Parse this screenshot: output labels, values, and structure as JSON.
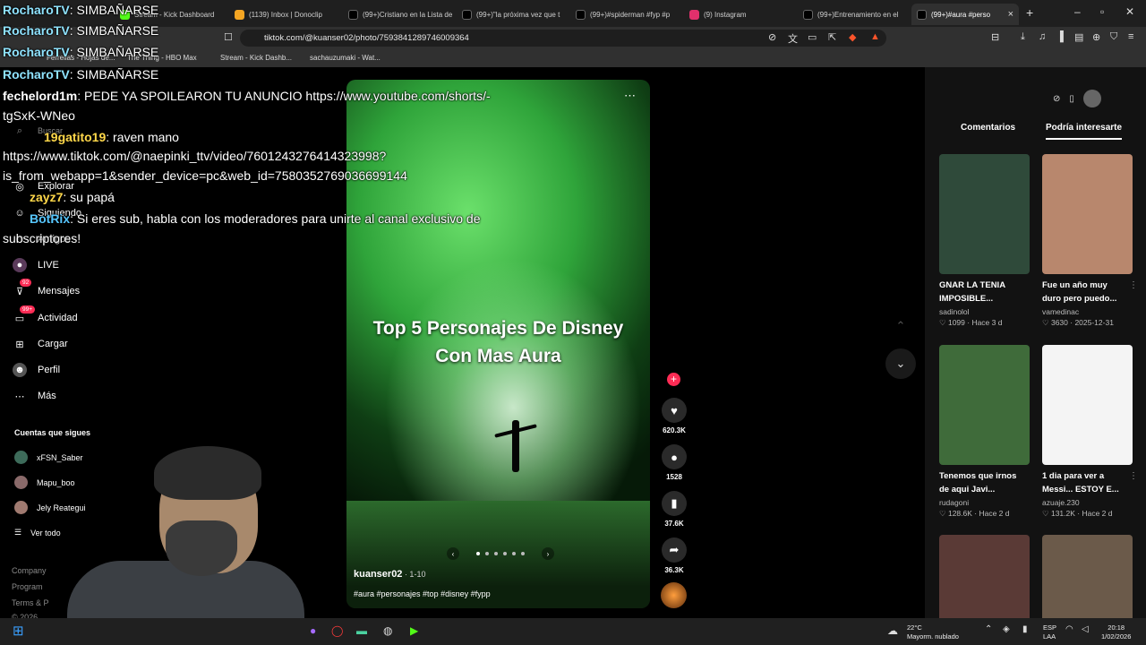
{
  "tabs": [
    {
      "label": "Stream - Kick Dashboard",
      "color": "#53fc18"
    },
    {
      "label": "(1139) Inbox | Donoclip",
      "color": "#f5a623"
    },
    {
      "label": "(99+)Cristiano en la Lista de",
      "color": "#ffffff"
    },
    {
      "label": "(99+)\"la próxima vez que t",
      "color": "#ffffff"
    },
    {
      "label": "(99+)#spiderman #fyp #p",
      "color": "#ffffff"
    },
    {
      "label": "(9) Instagram",
      "color": "#e1306c"
    },
    {
      "label": "(99+)Entrenamiento en el",
      "color": "#ffffff"
    },
    {
      "label": "(99+)#aura #perso",
      "color": "#ffffff"
    }
  ],
  "address": {
    "url": "tiktok.com/@kuanser02/photo/7593841289746009364"
  },
  "bookmarks": [
    "Ferrellas - Hojas de...",
    "The Thing - HBO Max",
    "Stream - Kick Dashb...",
    "sachauzumaki - Wat..."
  ],
  "sidebar": {
    "search_placeholder": "Buscar",
    "items": [
      {
        "label": "Explorar",
        "icon": "compass-icon"
      },
      {
        "label": "Siguiendo",
        "icon": "following-icon"
      },
      {
        "label": "Amigos",
        "icon": "friends-icon"
      },
      {
        "label": "LIVE",
        "icon": "live-icon"
      },
      {
        "label": "Mensajes",
        "icon": "messages-icon",
        "badge": "92"
      },
      {
        "label": "Actividad",
        "icon": "activity-icon",
        "badge": "99+"
      },
      {
        "label": "Cargar",
        "icon": "upload-icon"
      },
      {
        "label": "Perfil",
        "icon": "profile-icon"
      },
      {
        "label": "Más",
        "icon": "more-icon"
      }
    ],
    "following_title": "Cuentas que sigues",
    "following": [
      "xFSN_Saber",
      "Mapu_boo",
      "Jely Reategui"
    ],
    "see_all": "Ver todo",
    "footer": [
      "Company",
      "Program",
      "Terms & P",
      "© 2026"
    ]
  },
  "post": {
    "title_line1": "Top 5 Personajes De Disney",
    "title_line2": "Con Mas Aura",
    "username": "kuanser02",
    "date": " · 1-10",
    "tags": "#aura #personajes #top #disney #fypp",
    "likes": "620.3K",
    "comments": "1528",
    "saves": "37.6K",
    "shares": "36.3K"
  },
  "right_panel": {
    "tab_comments": "Comentarios",
    "tab_suggested": "Podría interesarte",
    "cards": [
      {
        "title1": "GNAR LA TENIA",
        "title2": "IMPOSIBLE...",
        "author": "sadinolol",
        "stats": "♡ 1099 · Hace 3 d",
        "thumb": "#2f4a3a"
      },
      {
        "title1": "Fue un año muy",
        "title2": "duro pero puedo...",
        "author": "vamedinac",
        "stats": "♡ 3630 · 2025-12-31",
        "thumb": "#b8876d"
      },
      {
        "title1": "Tenemos que irnos",
        "title2": "de aqui Javi...",
        "author": "rudagoni",
        "stats": "♡ 128.6K · Hace 2 d",
        "thumb": "#3f6b3a"
      },
      {
        "title1": "1 dia para ver a",
        "title2": "Messi... ESTOY E...",
        "author": "azuaje.230",
        "stats": "♡ 131.2K · Hace 2 d",
        "thumb": "#f4f4f4"
      },
      {
        "title1": "",
        "title2": "",
        "author": "",
        "stats": "",
        "thumb": "#5a3a36"
      },
      {
        "title1": "",
        "title2": "",
        "author": "",
        "stats": "",
        "thumb": "#6b5a4a"
      }
    ]
  },
  "chat": [
    {
      "user": "RocharoTV",
      "msg": ": SIMBAÑARSE",
      "color": "#8fe3ff"
    },
    {
      "user": "RocharoTV",
      "msg": ": SIMBAÑARSE",
      "color": "#8fe3ff"
    },
    {
      "user": "RocharoTV",
      "msg": ": SIMBAÑARSE",
      "color": "#8fe3ff"
    },
    {
      "user": "RocharoTV",
      "msg": ": SIMBAÑARSE",
      "color": "#8fe3ff"
    },
    {
      "user": "fechelord1m",
      "msg": ": PEDE YA SPOILEARON TU ANUNCIO https://www.youtube.com/shorts/-",
      "color": "#ffffff"
    },
    {
      "user": "",
      "msg": "tgSxK-WNeo",
      "color": "#ffffff"
    },
    {
      "user": "19gatito19",
      "msg": ": raven mano",
      "color": "#ffd84a"
    },
    {
      "user": "",
      "msg": "https://www.tiktok.com/@naepinki_ttv/video/7601243276414323998?",
      "color": "#ffffff"
    },
    {
      "user": "",
      "msg": "is_from_webapp=1&sender_device=pc&web_id=7580352769036699144",
      "color": "#ffffff"
    },
    {
      "user": "zayz7",
      "msg": ": su papá",
      "color": "#ffd84a"
    },
    {
      "user": "BotRix",
      "msg": ": Si eres sub, habla con los moderadores para unirte al canal exclusivo de",
      "color": "#57c7ff"
    },
    {
      "user": "",
      "msg": "subscriptores!",
      "color": "#ffffff"
    }
  ],
  "taskbar": {
    "temp": "22°C",
    "weather": "Mayorm. nublado",
    "lang1": "ESP",
    "lang2": "LAA",
    "time": "20:18",
    "date": "1/02/2026"
  }
}
